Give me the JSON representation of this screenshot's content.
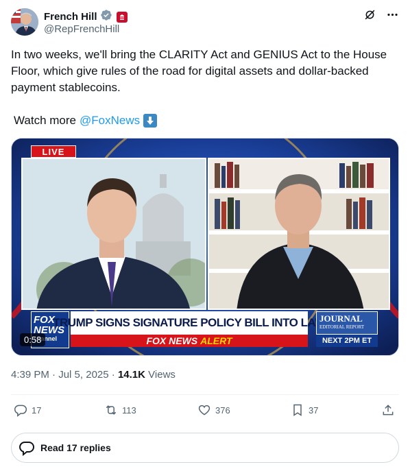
{
  "author": {
    "name": "French Hill",
    "handle": "@RepFrenchHill"
  },
  "tweet": {
    "text": "In two weeks, we'll bring the CLARITY Act and GENIUS Act to the House Floor, which give rules of the road for digital assets and dollar-backed payment stablecoins.",
    "watch_prefix": "Watch more",
    "watch_mention": "@FoxNews"
  },
  "video": {
    "live_badge": "LIVE",
    "fox_logo_line1": "FOX",
    "fox_logo_line2": "NEWS",
    "fox_logo_line3": "channel",
    "headline": "TRUMP SIGNS SIGNATURE POLICY BILL INTO LAW",
    "alert_brand": "FOX NEWS",
    "alert_word": "ALERT",
    "journal_title": "JOURNAL",
    "journal_sub": "EDITORIAL REPORT",
    "next_label": "NEXT 2PM ET",
    "duration": "0:58"
  },
  "meta": {
    "time": "4:39 PM",
    "date": "Jul 5, 2025",
    "views_count": "14.1K",
    "views_label": "Views"
  },
  "actions": {
    "replies": "17",
    "reposts": "113",
    "likes": "376",
    "bookmarks": "37"
  },
  "read_replies_label": "Read 17 replies",
  "colors": {
    "accent": "#1d9bf0",
    "secondary_text": "#536471",
    "live_red": "#d7141a"
  }
}
